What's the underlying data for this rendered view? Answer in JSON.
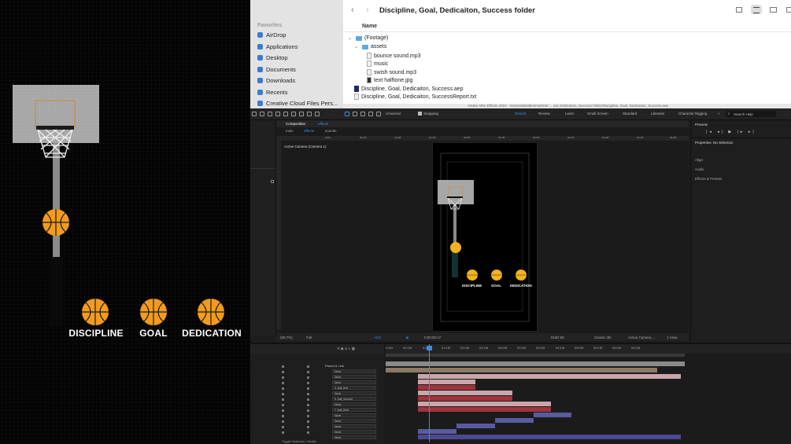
{
  "artwork": {
    "words": [
      "DISCIPLINE",
      "GOAL",
      "DEDICATION"
    ],
    "colors": {
      "ball": "#f39b1e",
      "ball_line": "#1a1a1a",
      "backboard": "#a7a7a7",
      "pole": "#8a8a8a",
      "rim": "#1a1a1a"
    }
  },
  "finder": {
    "title": "Discipline, Goal, Dedicaiton, Success folder",
    "column_name": "Name",
    "sidebar_heading": "Favorites",
    "sidebar": [
      "AirDrop",
      "Applications",
      "Desktop",
      "Documents",
      "Downloads",
      "Recents",
      "Creative Cloud Files Pers..."
    ],
    "tree": [
      {
        "label": "(Footage)",
        "kind": "folder",
        "level": 0
      },
      {
        "label": "assets",
        "kind": "folder",
        "level": 1
      },
      {
        "label": "bounce sound.mp3",
        "kind": "doc",
        "level": 2
      },
      {
        "label": "music",
        "kind": "doc",
        "level": 2
      },
      {
        "label": "swish sound.mp3",
        "kind": "doc",
        "level": 2
      },
      {
        "label": "text halftone.jpg",
        "kind": "img",
        "level": 2
      },
      {
        "label": "Discipline, Goal, Dedicaiton, Success.aep",
        "kind": "aep",
        "level": 0
      },
      {
        "label": "Discipline, Goal, Dedicaiton, SuccessReport.txt",
        "kind": "doc",
        "level": 0
      }
    ],
    "status_path": "Adobe After Effects 2024 - /Users/abdulkerimahmet ... oal, Dedication, Success folder/Discipline, Goal, Dedication, Success.aep"
  },
  "ae": {
    "toolbar": {
      "universal": "Universal",
      "snapping": "Snapping",
      "workspaces": [
        "Default",
        "Review",
        "Learn",
        "Small Screen",
        "Standard",
        "Libraries",
        "Character Rigging"
      ],
      "search": "Search Help"
    },
    "composition": {
      "panel_label": "Composition",
      "comp_name": "effects",
      "tabs": [
        "main",
        "effects",
        "sounds"
      ],
      "viewer_label": "Active Camera (Camera 1)",
      "ruler": [
        "0:00f",
        "00:15f",
        "01:00f",
        "01:15f",
        "02:00f",
        "02:15f",
        "03:00f",
        "03:15f",
        "04:00f",
        "04:15f",
        "05:00f"
      ],
      "words": [
        "DISCIPLINE",
        "GOAL",
        "DEDICATION"
      ],
      "zoom": "(60,7%)",
      "resolution": "Full",
      "exposure": "+0,0",
      "timecode": "0:00:00:17",
      "draft": "Draft 3D",
      "renderer": "Classic 3D",
      "camera": "Active Camera ...",
      "view": "1 View"
    },
    "right": {
      "preview": "Preview",
      "properties": "Properties: No Selection",
      "sections": [
        "Align",
        "Audio",
        "Effects & Presets"
      ]
    },
    "timeline": {
      "ruler": [
        "0:00f",
        "00:15f",
        "01:00f",
        "01:15f",
        "02:00f",
        "02:15f",
        "03:00f",
        "03:15f",
        "04:00f",
        "04:15f",
        "05:00f",
        "05:15f",
        "06:00f",
        "06:15f"
      ],
      "parent_header": "Parent & Link",
      "parents": [
        "None",
        "None",
        "None",
        "3. ball_first",
        "None",
        "5. ball_second",
        "None",
        "7. ball_third",
        "None",
        "None",
        "None",
        "None",
        "None"
      ],
      "footer": "Toggle Switches / Modes"
    }
  }
}
